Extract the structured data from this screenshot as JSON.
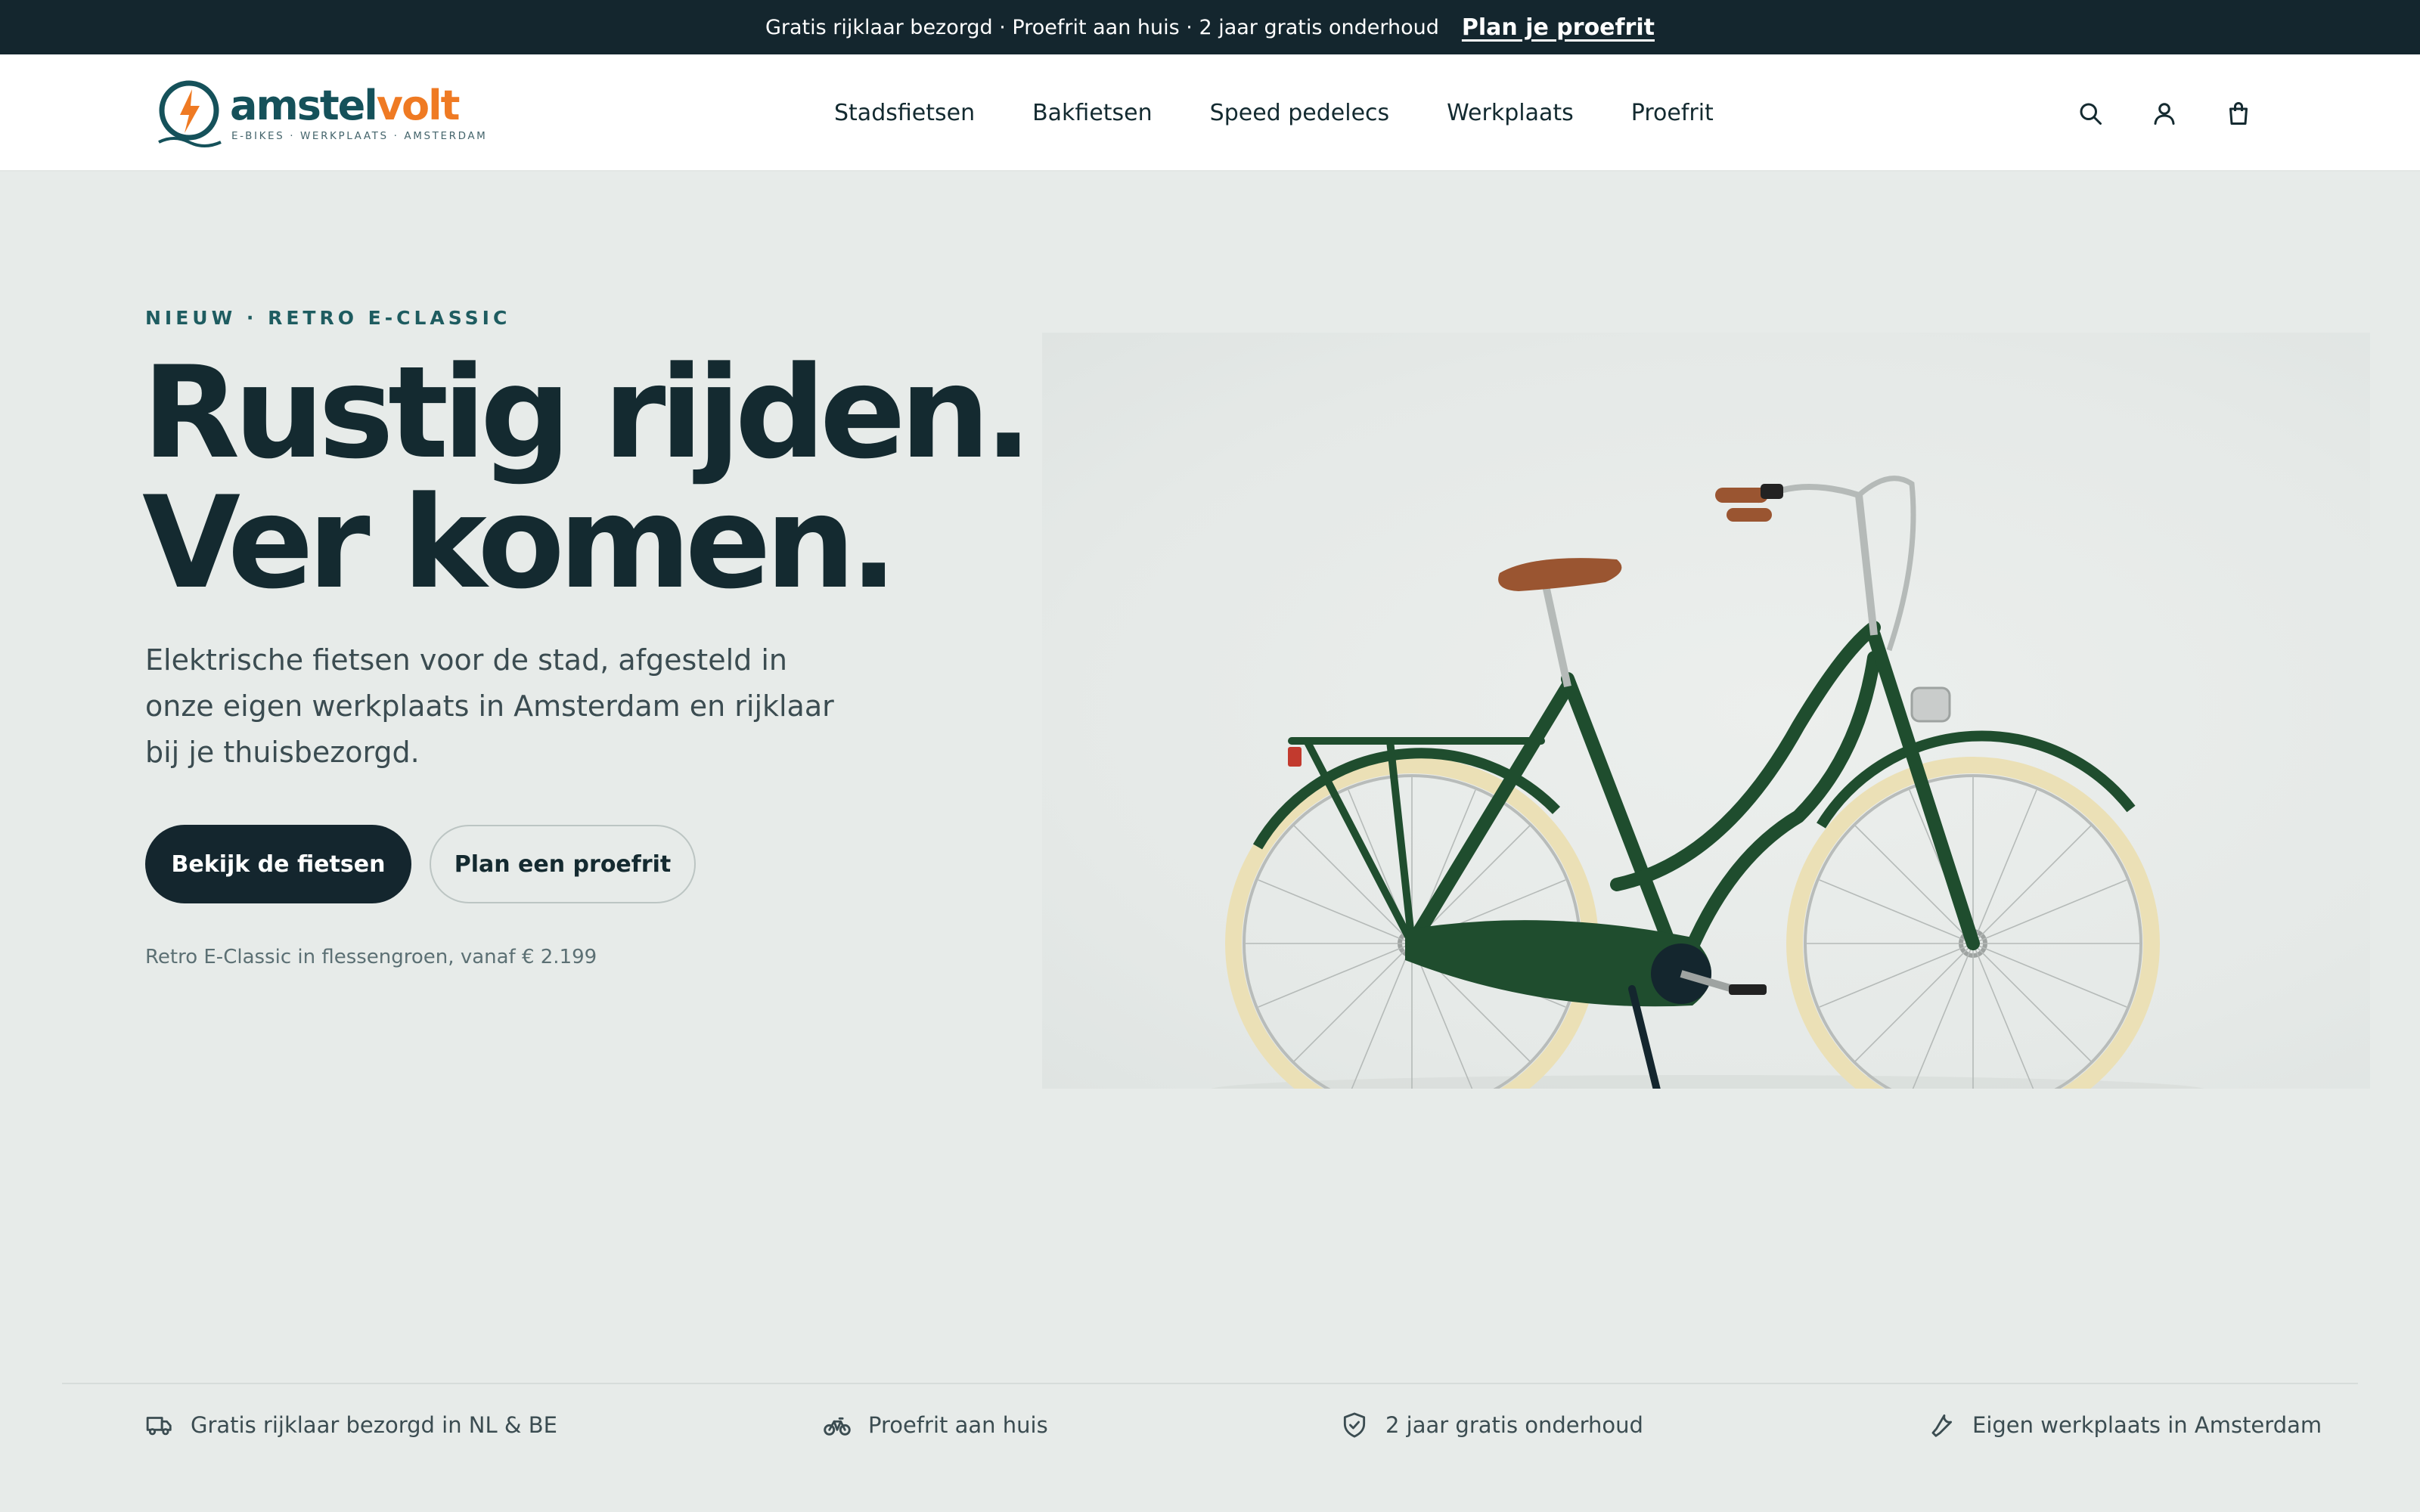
{
  "announcement": {
    "text": "Gratis rijklaar bezorgd · Proefrit aan huis · 2 jaar gratis onderhoud",
    "link_label": "Plan je proefrit"
  },
  "brand": {
    "name_part1": "amstel",
    "name_part2": "volt",
    "tagline": "E-BIKES · WERKPLAATS · AMSTERDAM",
    "primary_color": "#15515a",
    "accent_color": "#ef7a23"
  },
  "nav": {
    "items": [
      {
        "label": "Stadsfietsen"
      },
      {
        "label": "Bakfietsen"
      },
      {
        "label": "Speed pedelecs"
      },
      {
        "label": "Werkplaats"
      },
      {
        "label": "Proefrit"
      }
    ],
    "icons": [
      "search-icon",
      "account-icon",
      "cart-icon"
    ]
  },
  "hero": {
    "eyebrow": "NIEUW · RETRO E-CLASSIC",
    "headline_line1": "Rustig rijden.",
    "headline_line2": "Ver komen.",
    "lead": "Elektrische fietsen voor de stad, afgesteld in onze eigen werkplaats in Amsterdam en rijklaar bij je thuisbezorgd.",
    "cta_primary": "Bekijk de fietsen",
    "cta_secondary": "Plan een proefrit",
    "caption": "Retro E-Classic in flessengroen, vanaf € 2.199",
    "bike_color": "#1f4d2e"
  },
  "usps": [
    {
      "icon": "truck-icon",
      "label": "Gratis rijklaar bezorgd in NL & BE"
    },
    {
      "icon": "bicycle-icon",
      "label": "Proefrit aan huis"
    },
    {
      "icon": "shield-check-icon",
      "label": "2 jaar gratis onderhoud"
    },
    {
      "icon": "wrench-icon",
      "label": "Eigen werkplaats in Amsterdam"
    }
  ],
  "colors": {
    "dark": "#14262e",
    "background": "#e7ebe9",
    "text_muted": "#5c7074"
  }
}
